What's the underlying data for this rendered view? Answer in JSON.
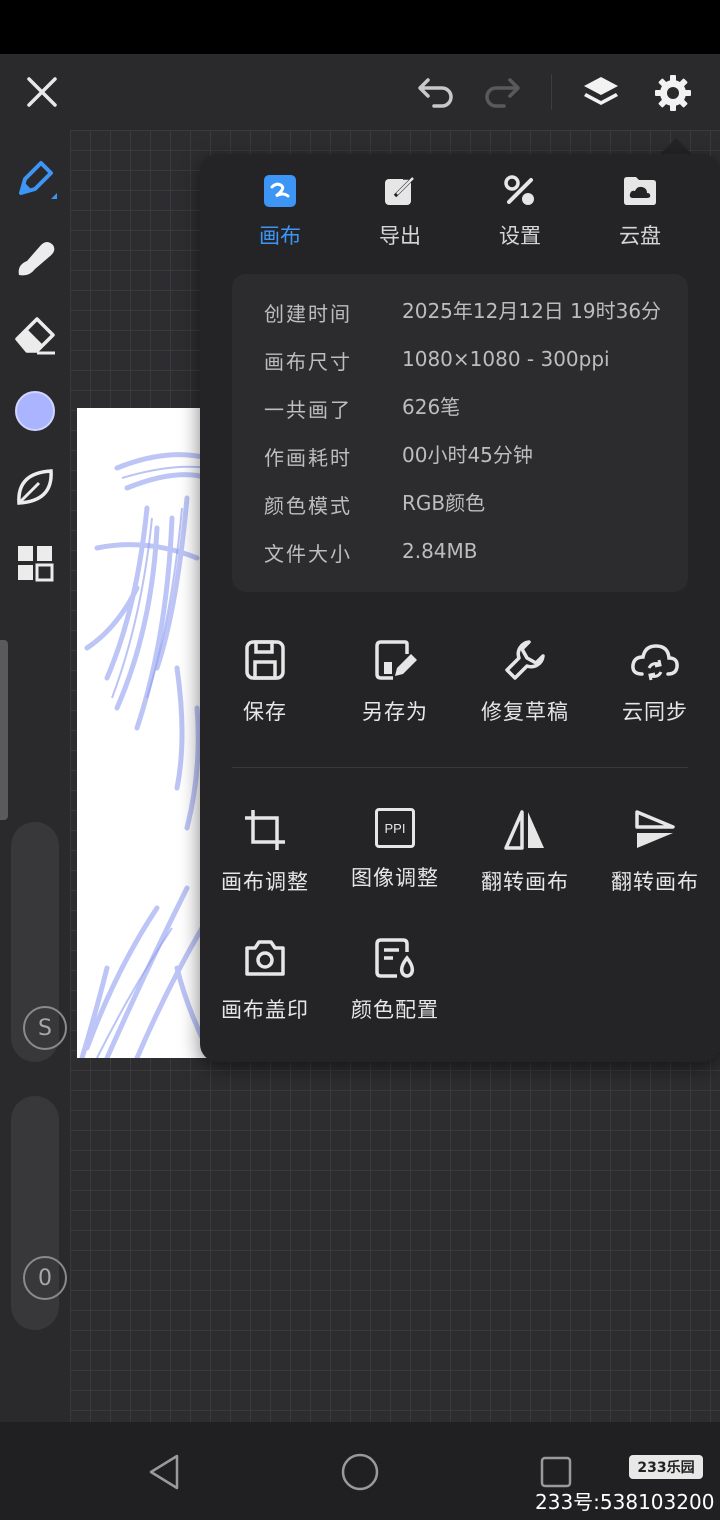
{
  "tabs": [
    {
      "label": "画布",
      "icon": "canvas-icon",
      "active": true
    },
    {
      "label": "导出",
      "icon": "export-icon",
      "active": false
    },
    {
      "label": "设置",
      "icon": "settings-tools-icon",
      "active": false
    },
    {
      "label": "云盘",
      "icon": "cloud-drive-icon",
      "active": false
    }
  ],
  "info": [
    {
      "key": "创建时间",
      "value": "2025年12月12日 19时36分"
    },
    {
      "key": "画布尺寸",
      "value": "1080×1080 - 300ppi"
    },
    {
      "key": "一共画了",
      "value": "626笔"
    },
    {
      "key": "作画耗时",
      "value": "00小时45分钟"
    },
    {
      "key": "颜色模式",
      "value": "RGB颜色"
    },
    {
      "key": "文件大小",
      "value": "2.84MB"
    }
  ],
  "actions": [
    {
      "label": "保存",
      "icon": "save-icon"
    },
    {
      "label": "另存为",
      "icon": "save-as-icon"
    },
    {
      "label": "修复草稿",
      "icon": "repair-wrench-icon"
    },
    {
      "label": "云同步",
      "icon": "cloud-sync-icon"
    },
    {
      "label": "画布调整",
      "icon": "crop-icon"
    },
    {
      "label": "图像调整",
      "icon": "ppi-icon"
    },
    {
      "label": "翻转画布",
      "icon": "flip-horizontal-icon"
    },
    {
      "label": "翻转画布",
      "icon": "flip-vertical-icon"
    },
    {
      "label": "画布盖印",
      "icon": "camera-stamp-icon"
    },
    {
      "label": "颜色配置",
      "icon": "color-config-icon"
    }
  ],
  "left_tools": {
    "brush_size_badge": "S",
    "opacity_badge": "0",
    "ppi_icon_text": "PPI",
    "active_color": "#aab4ff"
  },
  "accent_color": "#3d95f5",
  "watermark": {
    "badge": "233乐园",
    "text": "233号:538103200"
  }
}
